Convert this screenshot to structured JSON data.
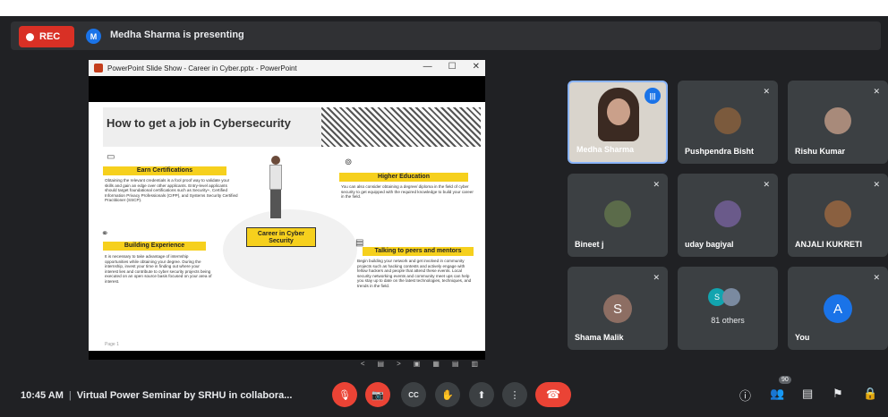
{
  "recording": {
    "label": "REC"
  },
  "presenter_bar": {
    "avatar_letter": "M",
    "text": "Medha Sharma is presenting"
  },
  "ppt_window": {
    "title": "PowerPoint Slide Show  -  Career in Cyber.pptx - PowerPoint",
    "controls": [
      "—",
      "☐",
      "✕"
    ],
    "nav": [
      "<",
      "▤",
      ">",
      "▣",
      "▦",
      "▤",
      "▥"
    ]
  },
  "slide": {
    "title": "How to get a job in Cybersecurity",
    "center_label": "Career in Cyber Security",
    "footer": "Page 1",
    "sections": [
      {
        "heading": "Earn Certifications",
        "text": "Obtaining the relevant credentials is a fool proof way to validate your skills and gain an edge over other applicants. Entry-level applicants should target foundational certifications such as Security+, Certified Information Privacy Professionals (CIPP), and Systems Security Certified Practitioner (SSCP)."
      },
      {
        "heading": "Higher Education",
        "text": "You can also consider obtaining a degree/ diploma in the field of cyber security to get equipped with the required knowledge to build your career in the field."
      },
      {
        "heading": "Building Experience",
        "text": "It is necessary to take advantage of internship opportunities while obtaining your degree. During the internship, invest your time in finding out where your interest lies and contribute to cyber security projects being executed on an open source basis focused on your area of interest."
      },
      {
        "heading": "Talking to peers and mentors",
        "text": "Begin building your network and get involved in community projects such as hacking contests and actively engage with fellow hackers and people that attend these events. Local security networking events and community meet ups can help you stay up to date on the latest technologies, techniques, and trends in the field."
      }
    ]
  },
  "participants": [
    {
      "name": "Medha Sharma",
      "speaking": true
    },
    {
      "name": "Pushpendra Bisht",
      "muted": true
    },
    {
      "name": "Rishu Kumar",
      "muted": true
    },
    {
      "name": "Bineet j",
      "muted": true
    },
    {
      "name": "uday bagiyal",
      "muted": true
    },
    {
      "name": "ANJALI KUKRETI",
      "muted": true
    },
    {
      "name": "Shama Malik",
      "letter": "S",
      "muted": true
    },
    {
      "name": "",
      "others_label": "81 others",
      "letter": "S"
    },
    {
      "name": "You",
      "letter": "A",
      "muted": true
    }
  ],
  "bottom_bar": {
    "time": "10:45 AM",
    "meeting_title": "Virtual Power Seminar by SRHU in collabora...",
    "people_count": "90",
    "icons": {
      "mic": "🎙",
      "camera": "📷",
      "captions": "CC",
      "raise_hand": "✋",
      "present": "⬆",
      "more": "⋮",
      "hangup": "☎",
      "info": "ⓘ",
      "people": "👥",
      "chat": "▤",
      "activities": "⚑",
      "host": "🔒"
    }
  },
  "colors": {
    "background": "#202124",
    "tile": "#3c4043",
    "accent_red": "#ea4335",
    "slide_yellow": "#f6d01d",
    "blue": "#1a73e8"
  }
}
